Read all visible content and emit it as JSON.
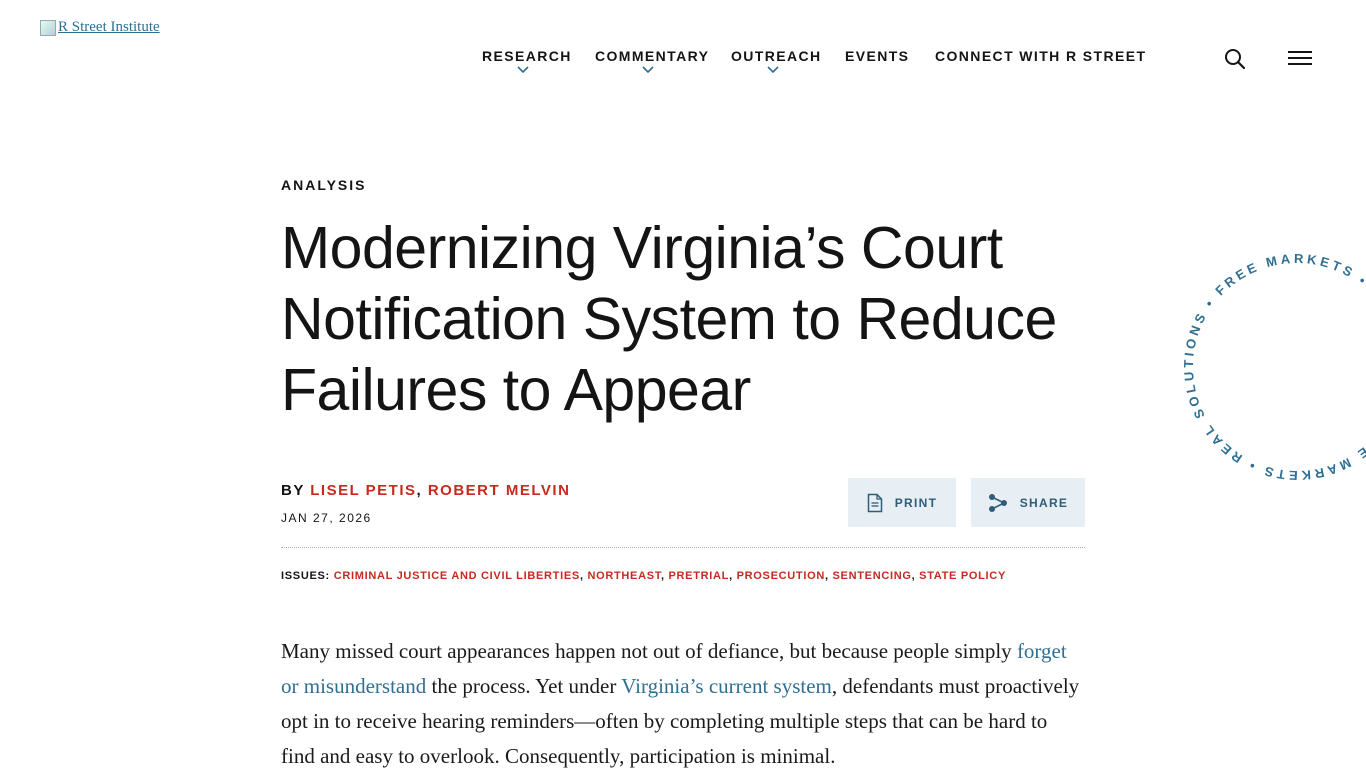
{
  "header": {
    "logo_alt": "R Street Institute",
    "nav": [
      {
        "label": "RESEARCH",
        "has_dropdown": true
      },
      {
        "label": "COMMENTARY",
        "has_dropdown": true
      },
      {
        "label": "OUTREACH",
        "has_dropdown": true
      },
      {
        "label": "EVENTS",
        "has_dropdown": false
      },
      {
        "label": "CONNECT WITH R STREET",
        "has_dropdown": false
      }
    ],
    "icons": [
      "search-icon",
      "hamburger-menu-icon"
    ]
  },
  "article": {
    "kicker": "ANALYSIS",
    "title": "Modernizing Virginia’s Court Notification System to Reduce Failures to Appear",
    "byline_prefix": "BY",
    "authors": [
      "LISEL PETIS",
      "ROBERT MELVIN"
    ],
    "author_separator": ",",
    "date": "JAN 27, 2026",
    "actions": {
      "print_label": "PRINT",
      "share_label": "SHARE",
      "print_icon": "document-icon",
      "share_icon": "share-icon"
    },
    "issues_label": "ISSUES:",
    "issues": [
      "CRIMINAL JUSTICE AND CIVIL LIBERTIES",
      "NORTHEAST",
      "PRETRIAL",
      "PROSECUTION",
      "SENTENCING",
      "STATE POLICY"
    ],
    "body": {
      "p1_part1": "Many missed court appearances happen not out of defiance, but because people simply ",
      "p1_link1": "forget or misunderstand",
      "p1_part2": " the process. Yet under ",
      "p1_link2": "Virginia’s current system",
      "p1_part3": ", defendants must proactively opt in to receive hearing reminders—often by completing multiple steps that can be hard to find and easy to overlook. Consequently, participation is minimal."
    }
  },
  "badge": {
    "text": "FREE MARKETS • REAL SOLUTIONS • FREE MARKETS • REAL SOLUTIONS • "
  },
  "colors": {
    "accent_red": "#c8291f",
    "link_blue": "#2f6f92",
    "button_bg": "#e7eff4",
    "button_text": "#2f5d78",
    "badge_text": "#2f6f92"
  }
}
